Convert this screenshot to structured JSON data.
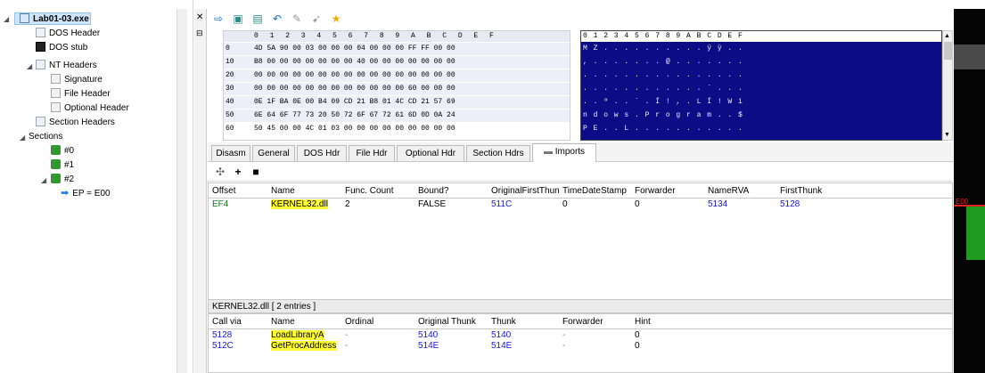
{
  "tree": {
    "root": "Lab01-03.exe",
    "nodes": [
      "DOS Header",
      "DOS stub",
      "NT Headers",
      "Signature",
      "File Header",
      "Optional Header",
      "Section Headers",
      "Sections",
      "#0",
      "#1",
      "#2",
      "EP = E00"
    ]
  },
  "toolbar": {
    "icons": [
      "arrow-icon",
      "save-icon",
      "save-as-icon",
      "undo-icon",
      "wrench-icon",
      "pointer-icon",
      "star-icon"
    ]
  },
  "hex": {
    "header": "0 1 2 3 4 5 6 7 8 9 A B C D E F",
    "rows": [
      {
        "off": "0",
        "bytes": "4D 5A 90 00 03 00 00 00 04 00 00 00 FF FF 00 00"
      },
      {
        "off": "10",
        "bytes": "B8 00 00 00 00 00 00 00 40 00 00 00 00 00 00 00"
      },
      {
        "off": "20",
        "bytes": "00 00 00 00 00 00 00 00 00 00 00 00 00 00 00 00"
      },
      {
        "off": "30",
        "bytes": "00 00 00 00 00 00 00 00 00 00 00 00 60 00 00 00"
      },
      {
        "off": "40",
        "bytes": "0E 1F BA 0E 00 B4 09 CD 21 B8 01 4C CD 21 57 69"
      },
      {
        "off": "50",
        "bytes": "6E 64 6F 77 73 20 50 72 6F 67 72 61 6D 0D 0A 24"
      },
      {
        "off": "60",
        "bytes": "50 45 00 00 4C 01 03 00 00 00 00 00 00 00 00 00"
      }
    ]
  },
  "ascii": {
    "header": "0 1 2 3 4 5 6 7 8 9 A B C D E F",
    "rows": [
      "M Z . . . . . . . . . . ÿ ÿ . .",
      ", . . . . . . . @ . . . . . . .",
      ". . . . . . . . . . . . . . . .",
      ". . . . . . . . . . . . ` . . .",
      ". . º . . ´ . Í ! , . L Í ! W i",
      "n d o w s . P r o g r a m . . $",
      "P E . . L . . . . . . . . . . ."
    ]
  },
  "tabs": [
    "Disasm",
    "General",
    "DOS Hdr",
    "File Hdr",
    "Optional Hdr",
    "Section Hdrs",
    "Imports"
  ],
  "imports": {
    "columns": [
      "Offset",
      "Name",
      "Func. Count",
      "Bound?",
      "OriginalFirstThun",
      "TimeDateStamp",
      "Forwarder",
      "NameRVA",
      "FirstThunk"
    ],
    "rows": [
      {
        "offset": "EF4",
        "name": "KERNEL32.dll",
        "count": "2",
        "bound": "FALSE",
        "oft": "511C",
        "tds": "0",
        "fwd": "0",
        "namerva": "5134",
        "ft": "5128"
      }
    ]
  },
  "funcs_label": "KERNEL32.dll   [ 2 entries ]",
  "funcs": {
    "columns": [
      "Call via",
      "Name",
      "Ordinal",
      "Original Thunk",
      "Thunk",
      "Forwarder",
      "Hint"
    ],
    "rows": [
      {
        "callvia": "5128",
        "name": "LoadLibraryA",
        "ordinal": "-",
        "othunk": "5140",
        "thunk": "5140",
        "fwd": "-",
        "hint": "0"
      },
      {
        "callvia": "512C",
        "name": "GetProcAddress",
        "ordinal": "-",
        "othunk": "514E",
        "thunk": "514E",
        "fwd": "-",
        "hint": "0"
      }
    ]
  },
  "rpanel": {
    "marker": "E00"
  },
  "colors": {
    "ascii_bg": "#0c0c86",
    "highlight": "#ffff33",
    "link": "#1a1ad4",
    "offset": "#107810"
  }
}
